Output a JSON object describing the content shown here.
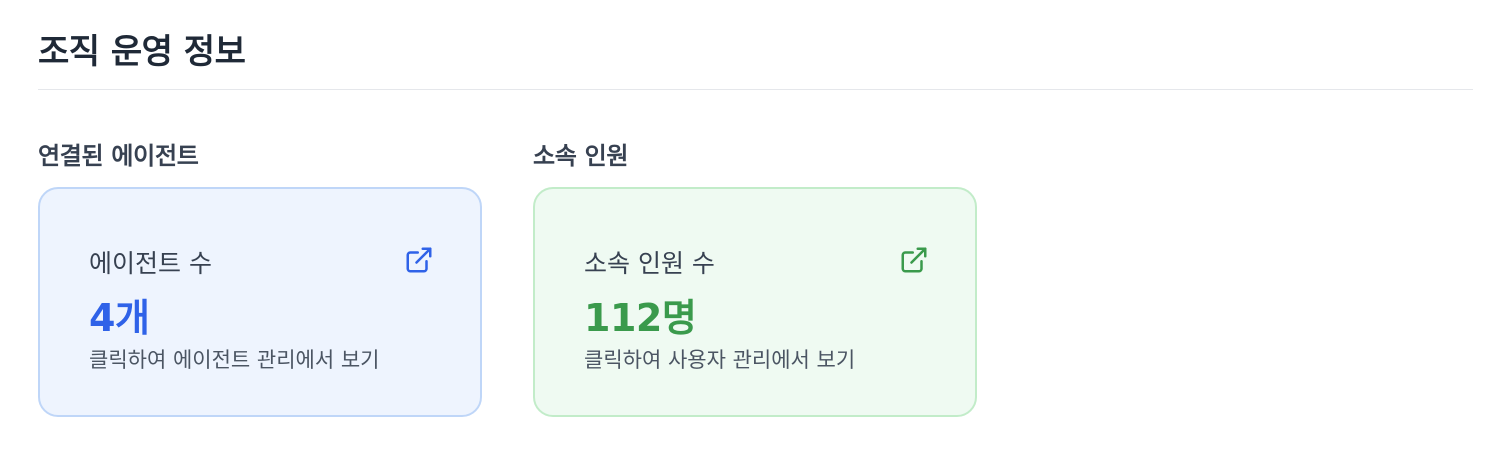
{
  "page": {
    "title": "조직 운영 정보"
  },
  "sections": [
    {
      "title": "연결된 에이전트",
      "card": {
        "label": "에이전트 수",
        "value": "4개",
        "hint": "클릭하여 에이전트 관리에서 보기",
        "icon": "external-link-icon",
        "accent_color": "#2f62e8",
        "background_color": "#eef4fe",
        "border_color": "#bfd6f8"
      }
    },
    {
      "title": "소속 인원",
      "card": {
        "label": "소속 인원 수",
        "value": "112명",
        "hint": "클릭하여 사용자 관리에서 보기",
        "icon": "external-link-icon",
        "accent_color": "#3a9a4c",
        "background_color": "#effaf2",
        "border_color": "#c2ecc9"
      }
    }
  ]
}
